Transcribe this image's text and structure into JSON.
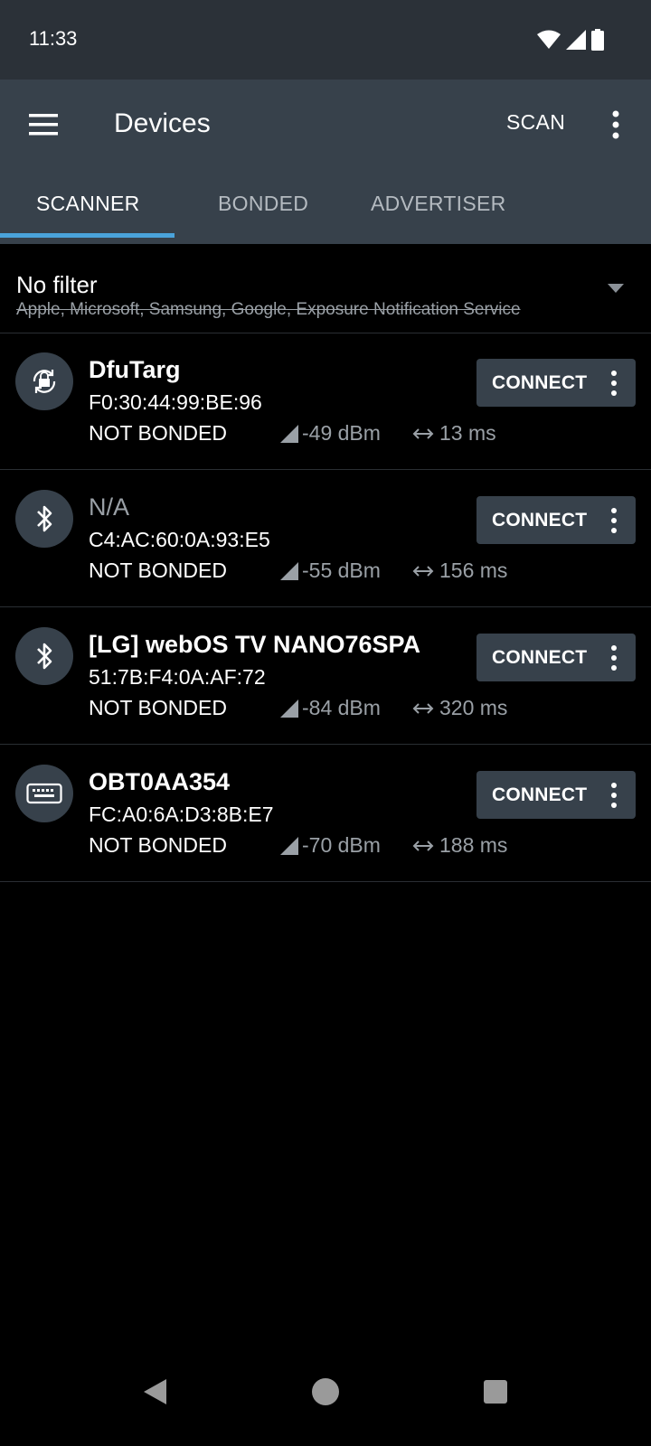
{
  "status": {
    "time": "11:33",
    "icons": [
      "wifi-icon",
      "cell-signal-icon",
      "battery-icon"
    ]
  },
  "app_bar": {
    "title": "Devices",
    "scan_label": "SCAN",
    "tabs": [
      {
        "label": "SCANNER",
        "active": true
      },
      {
        "label": "BONDED",
        "active": false
      },
      {
        "label": "ADVERTISER",
        "active": false
      }
    ]
  },
  "filter": {
    "title": "No filter",
    "excluded": "Apple, Microsoft, Samsung, Google, Exposure Notification Service"
  },
  "devices": [
    {
      "icon": "dfu-lock-icon",
      "name": "DfuTarg",
      "address": "F0:30:44:99:BE:96",
      "bond": "NOT BONDED",
      "rssi": "-49 dBm",
      "interval": "13 ms",
      "connect": "CONNECT"
    },
    {
      "icon": "bluetooth-icon",
      "name": "N/A",
      "address": "C4:AC:60:0A:93:E5",
      "bond": "NOT BONDED",
      "rssi": "-55 dBm",
      "interval": "156 ms",
      "connect": "CONNECT"
    },
    {
      "icon": "bluetooth-icon",
      "name": "[LG] webOS TV NANO76SPA",
      "address": "51:7B:F4:0A:AF:72",
      "bond": "NOT BONDED",
      "rssi": "-84 dBm",
      "interval": "320 ms",
      "connect": "CONNECT"
    },
    {
      "icon": "keyboard-icon",
      "name": "OBT0AA354",
      "address": "FC:A0:6A:D3:8B:E7",
      "bond": "NOT BONDED",
      "rssi": "-70 dBm",
      "interval": "188 ms",
      "connect": "CONNECT"
    }
  ],
  "colors": {
    "app_bar": "#37414b",
    "status_bar": "#2b3138",
    "accent": "#4aa3db",
    "background": "#000000"
  }
}
